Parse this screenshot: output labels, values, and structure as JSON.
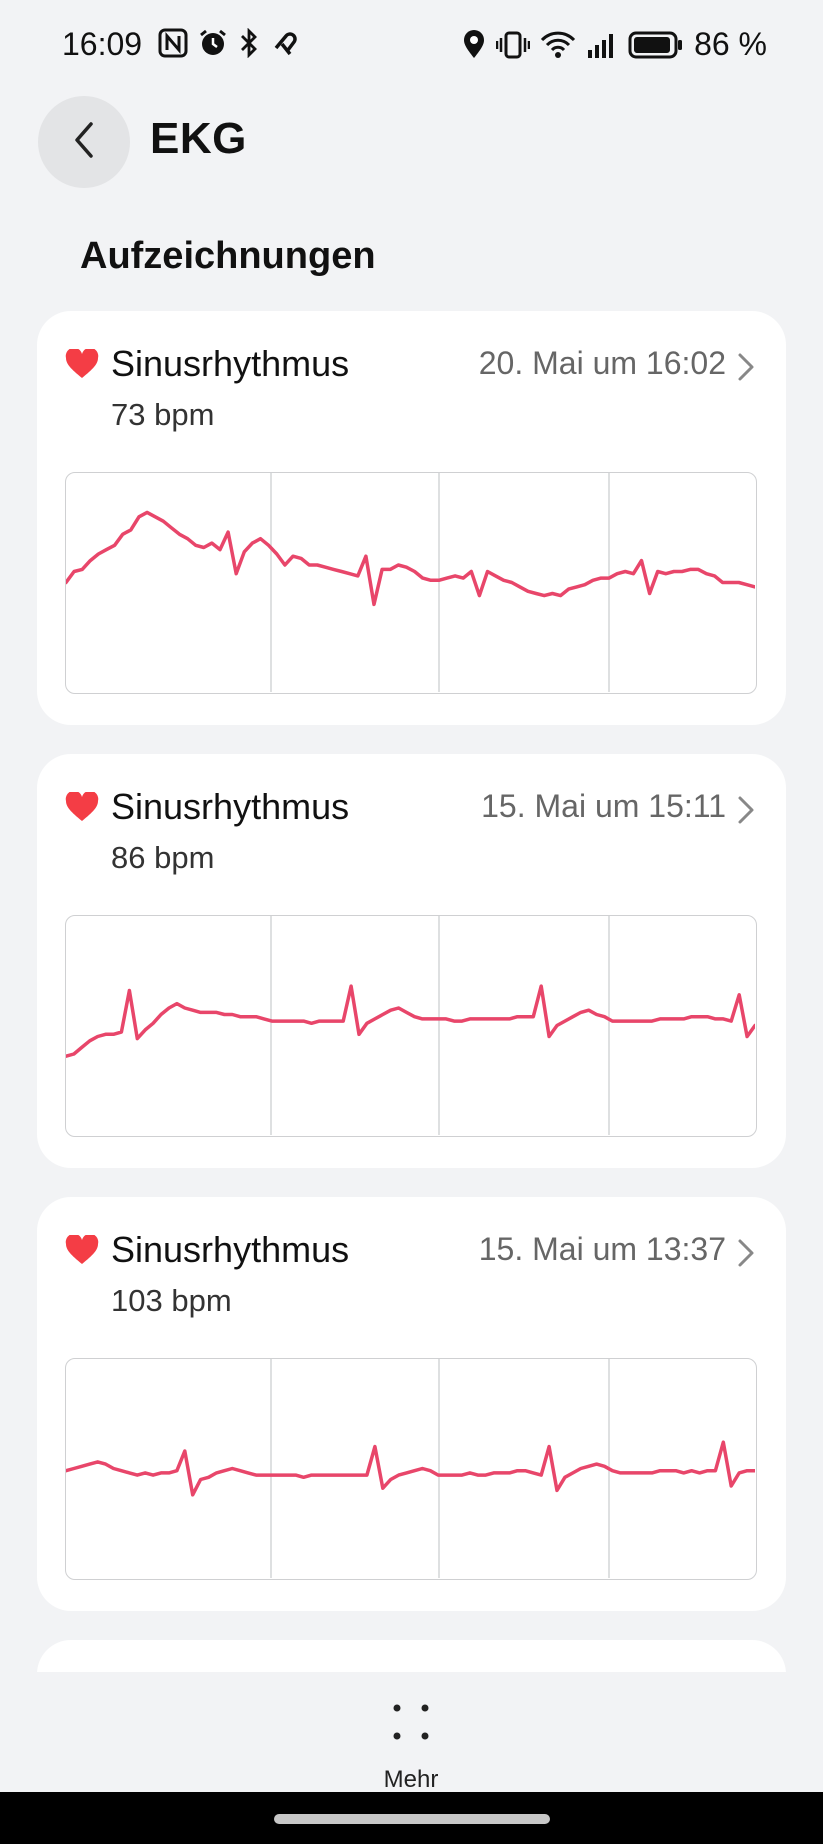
{
  "status": {
    "time": "16:09",
    "battery": "86 %",
    "icons": [
      "nfc-icon",
      "alarm-icon",
      "bluetooth-icon",
      "link-icon",
      "location-icon",
      "vibrate-icon",
      "wifi-icon",
      "signal-icon",
      "battery-icon"
    ]
  },
  "header": {
    "title": "EKG",
    "back_icon": "chevron-left-icon"
  },
  "section": {
    "title": "Aufzeichnungen"
  },
  "records": [
    {
      "title": "Sinusrhythmus",
      "date": "20. Mai um 16:02",
      "bpm": "73 bpm",
      "ecg": [
        0.5,
        0.45,
        0.44,
        0.4,
        0.37,
        0.35,
        0.33,
        0.28,
        0.26,
        0.2,
        0.18,
        0.2,
        0.22,
        0.25,
        0.28,
        0.3,
        0.33,
        0.34,
        0.32,
        0.35,
        0.27,
        0.46,
        0.36,
        0.32,
        0.3,
        0.33,
        0.37,
        0.42,
        0.38,
        0.39,
        0.42,
        0.42,
        0.43,
        0.44,
        0.45,
        0.46,
        0.47,
        0.38,
        0.6,
        0.44,
        0.44,
        0.42,
        0.43,
        0.45,
        0.48,
        0.49,
        0.49,
        0.48,
        0.47,
        0.48,
        0.45,
        0.56,
        0.45,
        0.47,
        0.49,
        0.5,
        0.52,
        0.54,
        0.55,
        0.56,
        0.55,
        0.56,
        0.53,
        0.52,
        0.51,
        0.49,
        0.48,
        0.48,
        0.46,
        0.45,
        0.46,
        0.4,
        0.55,
        0.45,
        0.46,
        0.45,
        0.45,
        0.44,
        0.44,
        0.46,
        0.47,
        0.5,
        0.5,
        0.5,
        0.51,
        0.52
      ],
      "gridlines": [
        0.3,
        0.59,
        0.88
      ]
    },
    {
      "title": "Sinusrhythmus",
      "date": "15. Mai um 15:11",
      "bpm": "86 bpm",
      "ecg": [
        0.64,
        0.63,
        0.6,
        0.57,
        0.55,
        0.54,
        0.54,
        0.53,
        0.34,
        0.56,
        0.52,
        0.49,
        0.45,
        0.42,
        0.4,
        0.42,
        0.43,
        0.44,
        0.44,
        0.44,
        0.45,
        0.45,
        0.46,
        0.46,
        0.46,
        0.47,
        0.48,
        0.48,
        0.48,
        0.48,
        0.48,
        0.49,
        0.48,
        0.48,
        0.48,
        0.48,
        0.32,
        0.54,
        0.49,
        0.47,
        0.45,
        0.43,
        0.42,
        0.44,
        0.46,
        0.47,
        0.47,
        0.47,
        0.47,
        0.48,
        0.48,
        0.47,
        0.47,
        0.47,
        0.47,
        0.47,
        0.47,
        0.46,
        0.46,
        0.46,
        0.32,
        0.55,
        0.5,
        0.48,
        0.46,
        0.44,
        0.43,
        0.45,
        0.46,
        0.48,
        0.48,
        0.48,
        0.48,
        0.48,
        0.48,
        0.47,
        0.47,
        0.47,
        0.47,
        0.46,
        0.46,
        0.46,
        0.47,
        0.47,
        0.48,
        0.36,
        0.55,
        0.5
      ]
    },
    {
      "title": "Sinusrhythmus",
      "date": "15. Mai um 13:37",
      "bpm": "103 bpm",
      "ecg": [
        0.51,
        0.5,
        0.49,
        0.48,
        0.47,
        0.48,
        0.5,
        0.51,
        0.52,
        0.53,
        0.52,
        0.53,
        0.52,
        0.52,
        0.51,
        0.42,
        0.62,
        0.55,
        0.54,
        0.52,
        0.51,
        0.5,
        0.51,
        0.52,
        0.53,
        0.53,
        0.53,
        0.53,
        0.53,
        0.53,
        0.54,
        0.53,
        0.53,
        0.53,
        0.53,
        0.53,
        0.53,
        0.53,
        0.53,
        0.4,
        0.59,
        0.55,
        0.53,
        0.52,
        0.51,
        0.5,
        0.51,
        0.53,
        0.53,
        0.53,
        0.53,
        0.52,
        0.53,
        0.53,
        0.52,
        0.52,
        0.52,
        0.51,
        0.51,
        0.52,
        0.53,
        0.4,
        0.6,
        0.54,
        0.52,
        0.5,
        0.49,
        0.48,
        0.49,
        0.51,
        0.52,
        0.52,
        0.52,
        0.52,
        0.52,
        0.51,
        0.51,
        0.51,
        0.52,
        0.51,
        0.52,
        0.51,
        0.51,
        0.38,
        0.58,
        0.52,
        0.51,
        0.51
      ]
    }
  ],
  "bottom": {
    "more_label": "Mehr",
    "more_icon": "more-dots-icon"
  },
  "colors": {
    "ecg_line": "#e8466a",
    "heart": "#f43d45",
    "background": "#f2f3f5",
    "card": "#ffffff"
  }
}
